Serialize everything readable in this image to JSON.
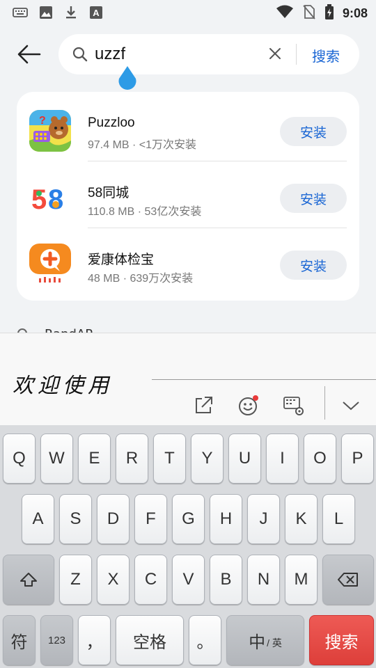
{
  "status": {
    "time": "9:08"
  },
  "search": {
    "query": "uzzf",
    "button_label": "搜索"
  },
  "results": [
    {
      "name": "Puzzloo",
      "meta": "97.4 MB · <1万次安装",
      "install_label": "安装"
    },
    {
      "name": "58同城",
      "meta": "110.8 MB · 53亿次安装",
      "install_label": "安装"
    },
    {
      "name": "爱康体检宝",
      "meta": "48 MB · 639万次安装",
      "install_label": "安装"
    }
  ],
  "suggestion_peek": "RandAP...",
  "ime": {
    "brand": "欢迎使用"
  },
  "keyboard": {
    "row1": [
      "Q",
      "W",
      "E",
      "R",
      "T",
      "Y",
      "U",
      "I",
      "O",
      "P"
    ],
    "row2": [
      "A",
      "S",
      "D",
      "F",
      "G",
      "H",
      "J",
      "K",
      "L"
    ],
    "row3": [
      "Z",
      "X",
      "C",
      "V",
      "B",
      "N",
      "M"
    ],
    "symbol_key": "符",
    "num_key": "123",
    "comma_key": "，",
    "space_key": "空格",
    "period_key": "。",
    "lang_key_main": "中",
    "lang_key_sub": "/ 英",
    "enter_key": "搜索"
  },
  "colors": {
    "accent": "#1a66d4",
    "enter": "#e44a45",
    "bg": "#f1f3f5"
  },
  "icons": [
    "keyboard-icon",
    "image-icon",
    "download-icon",
    "font-icon",
    "wifi-icon",
    "no-sim-icon",
    "battery-icon",
    "back-arrow-icon",
    "search-icon",
    "clear-icon",
    "share-icon",
    "emoji-icon",
    "keyboard-settings-icon",
    "collapse-icon",
    "shift-icon",
    "backspace-icon"
  ]
}
